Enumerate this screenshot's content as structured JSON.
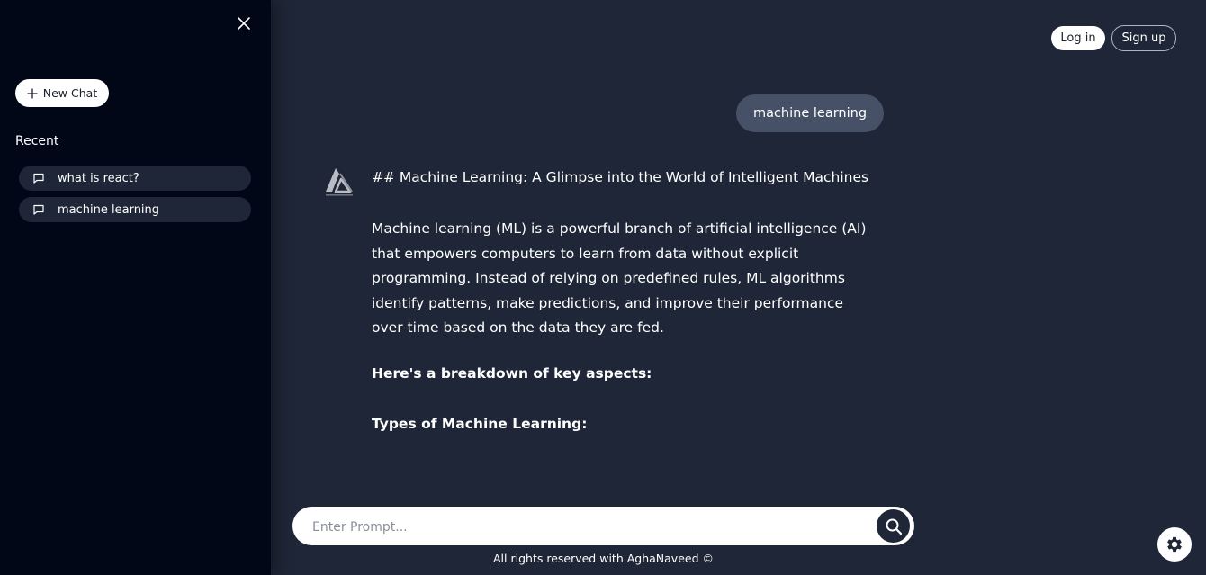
{
  "sidebar": {
    "new_chat_label": "New Chat",
    "recent_heading": "Recent",
    "recent_items": [
      {
        "label": "what is react?"
      },
      {
        "label": "machine learning"
      }
    ]
  },
  "header": {
    "login_label": "Log in",
    "signup_label": "Sign up"
  },
  "conversation": {
    "user_message": "machine learning",
    "response": {
      "heading": "## Machine Learning: A Glimpse into the World of Intelligent Machines",
      "paragraph": "Machine learning (ML) is a powerful branch of artificial intelligence (AI) that empowers computers to learn from data without explicit programming. Instead of relying on predefined rules, ML algorithms identify patterns, make predictions, and improve their performance over time based on the data they are fed.",
      "breakdown_heading": "Here's a breakdown of key aspects:",
      "types_heading": "Types of Machine Learning:"
    }
  },
  "prompt": {
    "placeholder": "Enter Prompt...",
    "value": ""
  },
  "footer": {
    "text": "All rights reserved with AghaNaveed ©"
  },
  "icons": {
    "close": "close-icon",
    "new_chat": "plus-icon",
    "recent_item": "chat-bubble-icon",
    "search": "search-icon",
    "settings": "gear-icon"
  },
  "colors": {
    "background": "#1f2637",
    "sidebar": "#020718",
    "user_bubble": "#465066",
    "white": "#ffffff"
  }
}
